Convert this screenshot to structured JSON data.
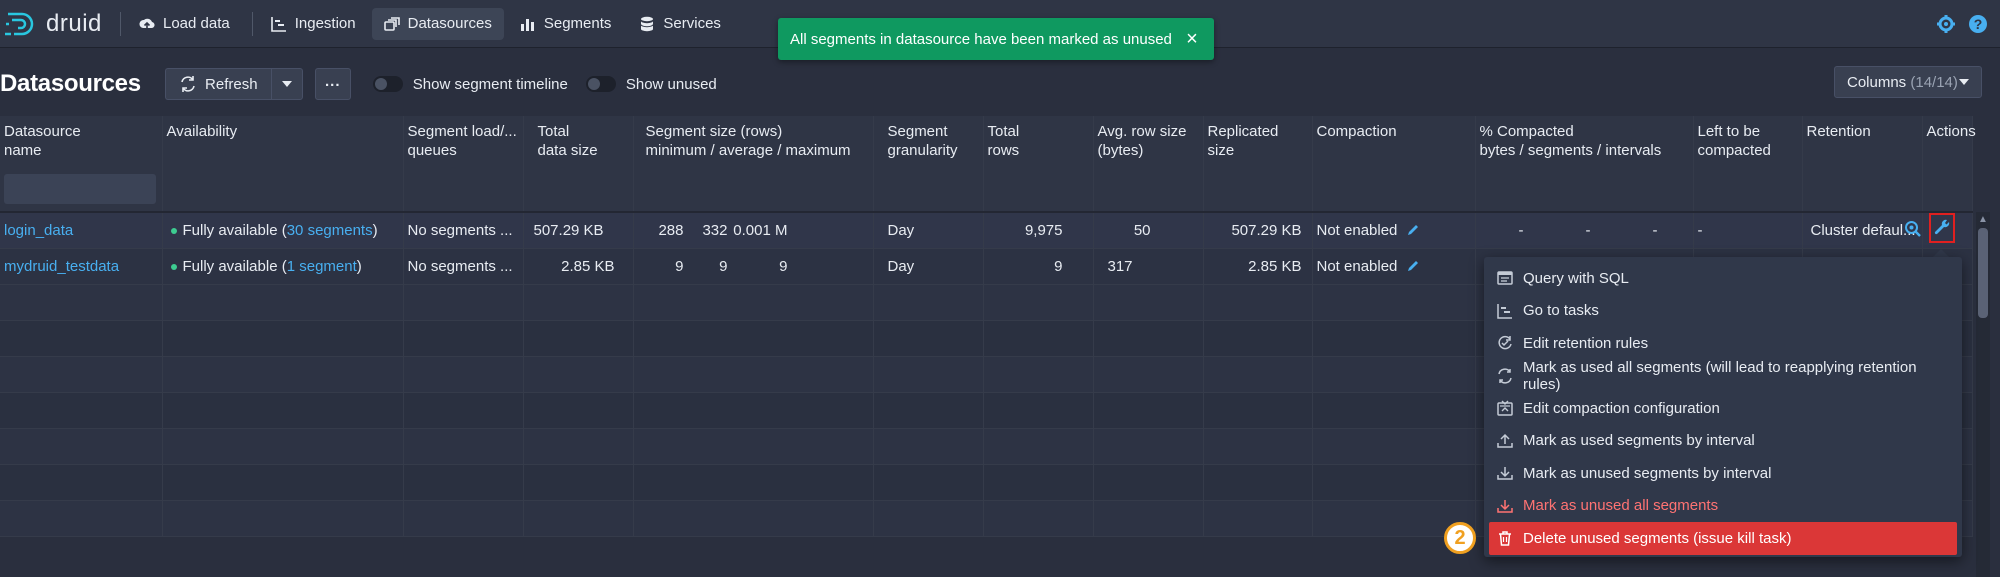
{
  "app": {
    "logo_text": "druid"
  },
  "nav": [
    {
      "label": "Load data",
      "icon": "cloud-upload-icon"
    },
    {
      "label": "Ingestion",
      "icon": "gantt-chart-icon"
    },
    {
      "label": "Datasources",
      "icon": "multi-select-icon",
      "active": true
    },
    {
      "label": "Segments",
      "icon": "stacked-chart-icon"
    },
    {
      "label": "Services",
      "icon": "database-icon"
    }
  ],
  "toast": {
    "message": "All segments in datasource have been marked as unused",
    "color": "#0f9960"
  },
  "controls": {
    "title": "Datasources",
    "refresh_label": "Refresh",
    "more_label": "...",
    "toggle_timeline": "Show segment timeline",
    "toggle_unused": "Show unused",
    "columns_label": "Columns",
    "columns_count": "(14/14)"
  },
  "table": {
    "headers": [
      [
        "Datasource",
        "name"
      ],
      [
        "Availability",
        ""
      ],
      [
        "Segment load/...",
        "queues"
      ],
      [
        "Total",
        "data size"
      ],
      [
        "Segment size (rows)",
        "minimum / average / maximum"
      ],
      [
        "Segment",
        "granularity"
      ],
      [
        "Total",
        "rows"
      ],
      [
        "Avg. row size",
        "(bytes)"
      ],
      [
        "Replicated",
        "size"
      ],
      [
        "Compaction",
        ""
      ],
      [
        "% Compacted",
        "bytes / segments / intervals"
      ],
      [
        "Left to be",
        "compacted"
      ],
      [
        "Retention",
        ""
      ],
      [
        "Actions",
        ""
      ]
    ],
    "rows": [
      {
        "name": "login_data",
        "availability_prefix": "Fully available (",
        "availability_link": "30 segments",
        "availability_suffix": ")",
        "load_queues": "No segments ...",
        "total_size": "507.29 KB",
        "seg_min": "288",
        "seg_avg": "332",
        "seg_max": "0.001 M",
        "granularity": "Day",
        "total_rows": "9,975",
        "avg_row": "50",
        "replicated": "507.29 KB",
        "compaction": "Not enabled",
        "pct_bytes": "-",
        "pct_segments": "-",
        "pct_intervals": "-",
        "left": "-",
        "retention": "Cluster defaul..."
      },
      {
        "name": "mydruid_testdata",
        "availability_prefix": "Fully available (",
        "availability_link": "1 segment",
        "availability_suffix": ")",
        "load_queues": "No segments ...",
        "total_size": "2.85 KB",
        "seg_min": "9",
        "seg_avg": "9",
        "seg_max": "9",
        "granularity": "Day",
        "total_rows": "9",
        "avg_row": "317",
        "replicated": "2.85 KB",
        "compaction": "Not enabled"
      }
    ]
  },
  "menu": {
    "items": [
      {
        "label": "Query with SQL",
        "icon": "application-icon"
      },
      {
        "label": "Go to tasks",
        "icon": "gantt-chart-icon"
      },
      {
        "label": "Edit retention rules",
        "icon": "automatic-updates-icon"
      },
      {
        "label": "Mark as used all segments (will lead to reapplying retention rules)",
        "icon": "refresh-icon"
      },
      {
        "label": "Edit compaction configuration",
        "icon": "compressed-icon"
      },
      {
        "label": "Mark as used segments by interval",
        "icon": "upload-icon"
      },
      {
        "label": "Mark as unused segments by interval",
        "icon": "download-icon"
      },
      {
        "label": "Mark as unused all segments",
        "icon": "download-icon",
        "danger": true
      },
      {
        "label": "Delete unused segments (issue kill task)",
        "icon": "trash-icon",
        "selected": true
      }
    ]
  },
  "annotation": {
    "step": "2"
  },
  "colors": {
    "accent": "#48aff0",
    "danger": "#db3737",
    "success": "#0f9960",
    "badge": "#f0a020"
  }
}
